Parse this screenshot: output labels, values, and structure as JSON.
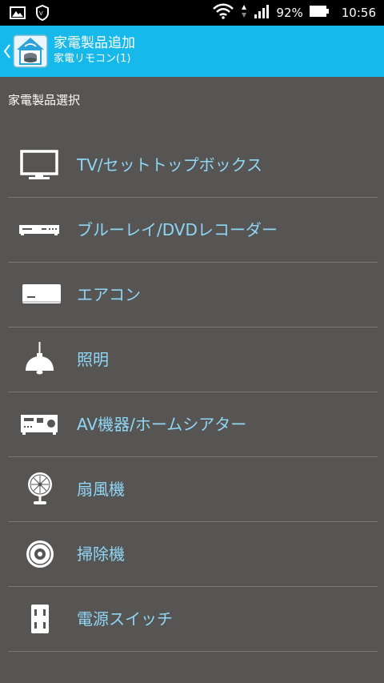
{
  "status_bar": {
    "battery_percent": "92%",
    "time": "10:56",
    "icons": [
      "image-icon",
      "vpn-shield-icon",
      "wifi-icon",
      "signal-icon",
      "battery-icon"
    ]
  },
  "app_bar": {
    "title": "家電製品追加",
    "subtitle": "家電リモコン(1)",
    "accent_color": "#16b9ea"
  },
  "section_header": "家電製品選択",
  "devices": [
    {
      "label": "TV/セットトップボックス",
      "icon": "tv-icon"
    },
    {
      "label": "ブルーレイ/DVDレコーダー",
      "icon": "bluray-recorder-icon"
    },
    {
      "label": "エアコン",
      "icon": "air-conditioner-icon"
    },
    {
      "label": "照明",
      "icon": "light-icon"
    },
    {
      "label": "AV機器/ホームシアター",
      "icon": "av-receiver-icon"
    },
    {
      "label": "扇風機",
      "icon": "fan-icon"
    },
    {
      "label": "掃除機",
      "icon": "vacuum-icon"
    },
    {
      "label": "電源スイッチ",
      "icon": "power-outlet-icon"
    }
  ],
  "colors": {
    "background": "#575553",
    "item_text": "#8fd6f5"
  }
}
